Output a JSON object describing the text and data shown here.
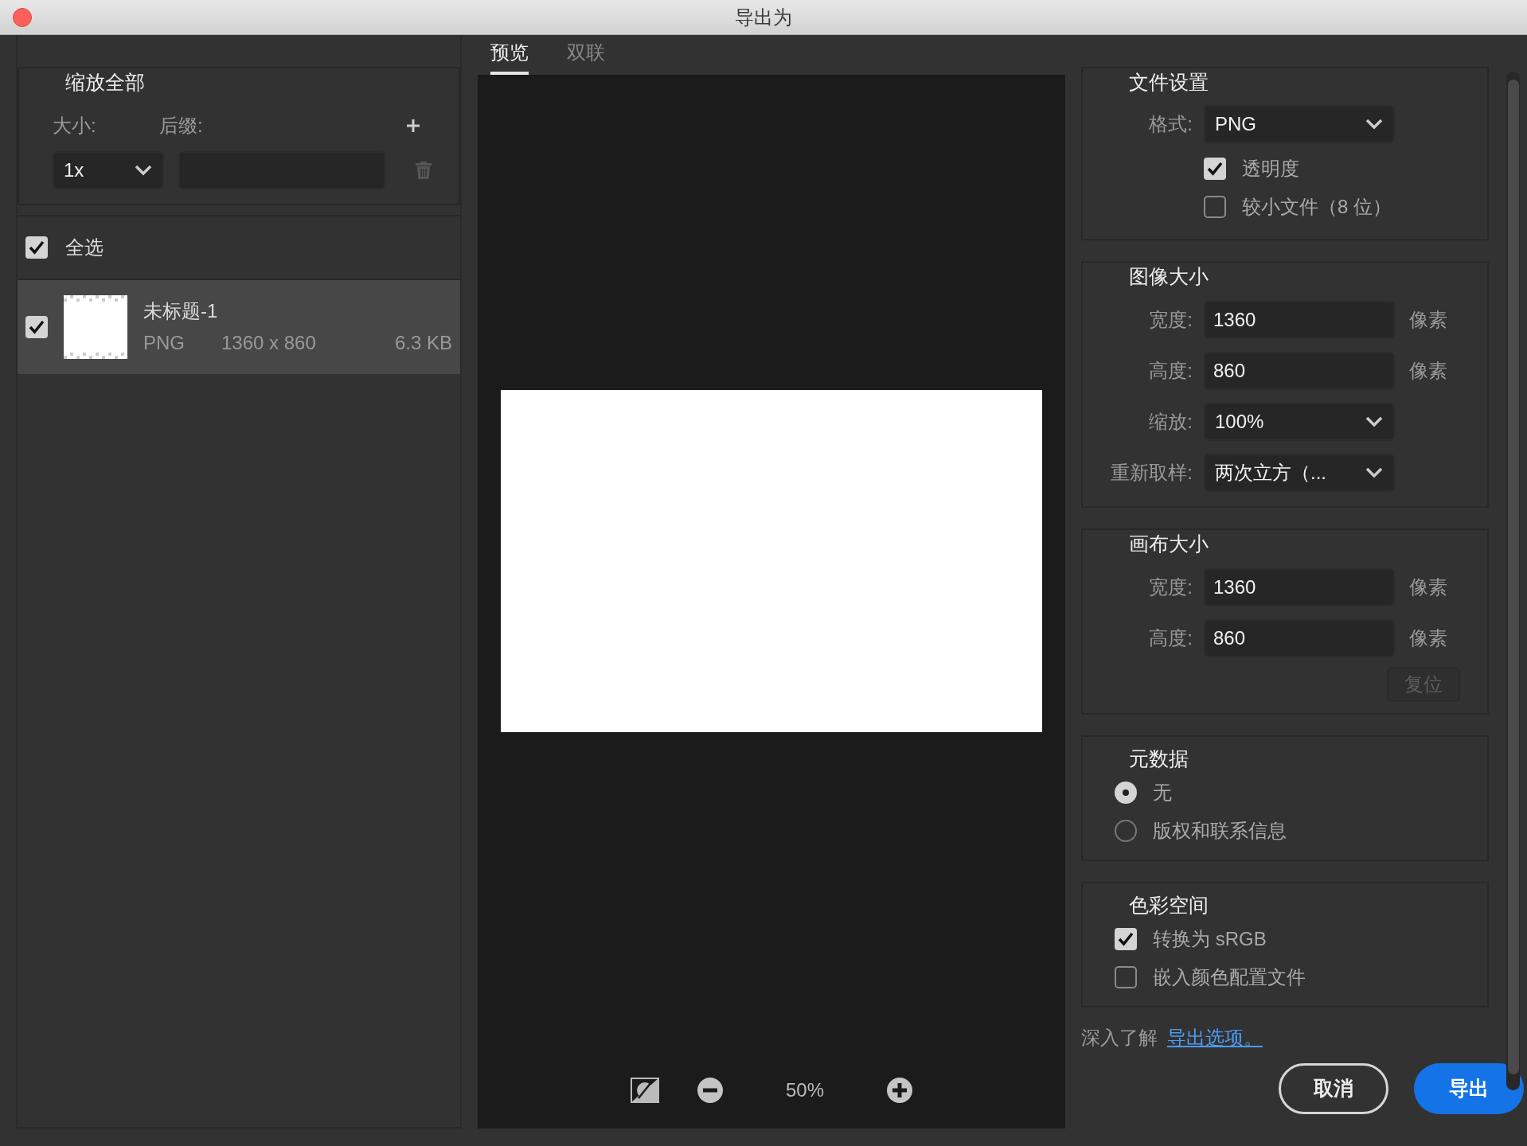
{
  "window": {
    "title": "导出为"
  },
  "scale_all": {
    "title": "缩放全部",
    "size_label": "大小:",
    "suffix_label": "后缀:",
    "size": "1x"
  },
  "select_all": {
    "label": "全选",
    "checked": true
  },
  "assets": [
    {
      "name": "未标题-1",
      "format": "PNG",
      "dimensions": "1360 x 860",
      "file_size": "6.3 KB",
      "checked": true,
      "selected": true
    }
  ],
  "preview_tabs": [
    {
      "label": "预览",
      "selected": true
    },
    {
      "label": "双联",
      "selected": false
    }
  ],
  "zoom": {
    "value": "50%"
  },
  "file_settings": {
    "title": "文件设置",
    "format_label": "格式:",
    "format": "PNG",
    "options": [
      {
        "label": "透明度",
        "checked": true
      },
      {
        "label": "较小文件（8 位）",
        "checked": false
      }
    ]
  },
  "image_size": {
    "title": "图像大小",
    "fields": [
      {
        "kind": "input",
        "label": "宽度:",
        "value": "1360",
        "unit": "像素"
      },
      {
        "kind": "input",
        "label": "高度:",
        "value": "860",
        "unit": "像素"
      },
      {
        "kind": "select",
        "label": "缩放:",
        "value": "100%"
      },
      {
        "kind": "select",
        "label": "重新取样:",
        "value": "两次立方（..."
      }
    ]
  },
  "canvas_size": {
    "title": "画布大小",
    "fields": [
      {
        "kind": "input",
        "label": "宽度:",
        "value": "1360",
        "unit": "像素"
      },
      {
        "kind": "input",
        "label": "高度:",
        "value": "860",
        "unit": "像素"
      }
    ],
    "reset_button": {
      "label": "复位",
      "disabled": true
    }
  },
  "metadata": {
    "title": "元数据",
    "options": [
      {
        "label": "无",
        "selected": true
      },
      {
        "label": "版权和联系信息",
        "selected": false
      }
    ]
  },
  "color_space": {
    "title": "色彩空间",
    "options": [
      {
        "label": "转换为 sRGB",
        "checked": true
      },
      {
        "label": "嵌入颜色配置文件",
        "checked": false
      }
    ]
  },
  "learn_more": {
    "text": "深入了解",
    "link": "导出选项。"
  },
  "buttons": [
    {
      "kind": "secondary",
      "label": "取消"
    },
    {
      "kind": "primary",
      "label": "导出"
    }
  ]
}
